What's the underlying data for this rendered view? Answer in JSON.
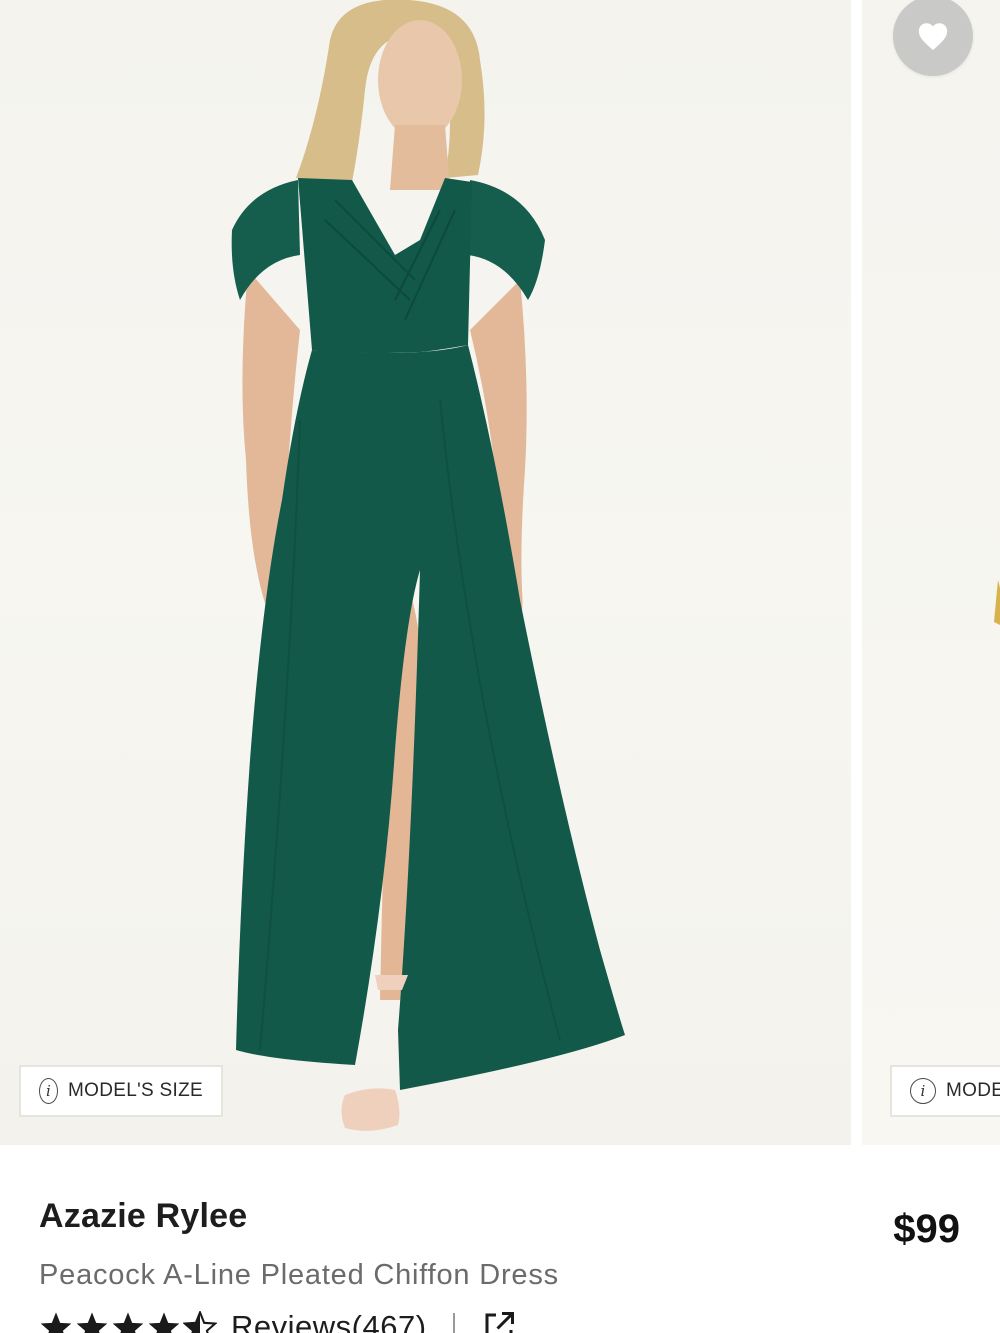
{
  "carousel": {
    "model_size_label": "MODEL'S SIZE",
    "next_tag_label": "MODE",
    "dress_color": "#13594a"
  },
  "wishlist": {
    "icon": "heart-icon"
  },
  "product": {
    "brand": "Azazie Rylee",
    "description": "Peacock A-Line Pleated Chiffon Dress",
    "price": "$99",
    "rating": 4.5,
    "reviews_label": "Reviews(467)"
  },
  "colors": {
    "dress": "#13594a",
    "background": "#f5f4ef",
    "wishlist_bg": "#c9c9c7",
    "text_primary": "#1d1d1d",
    "text_secondary": "#6b6b6b"
  }
}
